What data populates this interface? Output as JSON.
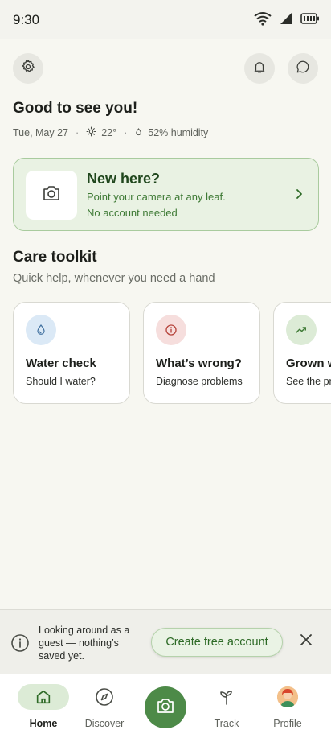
{
  "status_bar": {
    "time": "9:30"
  },
  "home": {
    "greeting": "Good to see you!",
    "date": "Tue, May 27",
    "temperature": "22°",
    "humidity": "52% humidity"
  },
  "new_card": {
    "title": "New here?",
    "line1": "Point your camera at any leaf.",
    "line2": "No account needed"
  },
  "toolkit": {
    "title": "Care toolkit",
    "subtitle": "Quick help, whenever you need a hand",
    "cards": [
      {
        "title": "Water check",
        "subtitle": "Should I water?",
        "icon": "water-drop-icon",
        "color": "#dbe9f6"
      },
      {
        "title": "What’s wrong?",
        "subtitle": "Diagnose problems",
        "icon": "info-icon",
        "color": "#f6dedd"
      },
      {
        "title": "Grown w",
        "subtitle": "See the pr",
        "icon": "trending-up-icon",
        "color": "#dcebd6"
      }
    ]
  },
  "guest_banner": {
    "message": "Looking around as a guest — nothing’s saved yet.",
    "button": "Create free account"
  },
  "nav": {
    "items": [
      {
        "label": "Home",
        "icon": "home-icon"
      },
      {
        "label": "Discover",
        "icon": "compass-icon"
      },
      {
        "label": "",
        "icon": "camera-icon"
      },
      {
        "label": "Track",
        "icon": "sprout-icon"
      },
      {
        "label": "Profile",
        "icon": "avatar"
      }
    ]
  },
  "colors": {
    "accent": "#4d8a48",
    "background": "#f7f7f1",
    "card_green": "#e9f2e3"
  }
}
